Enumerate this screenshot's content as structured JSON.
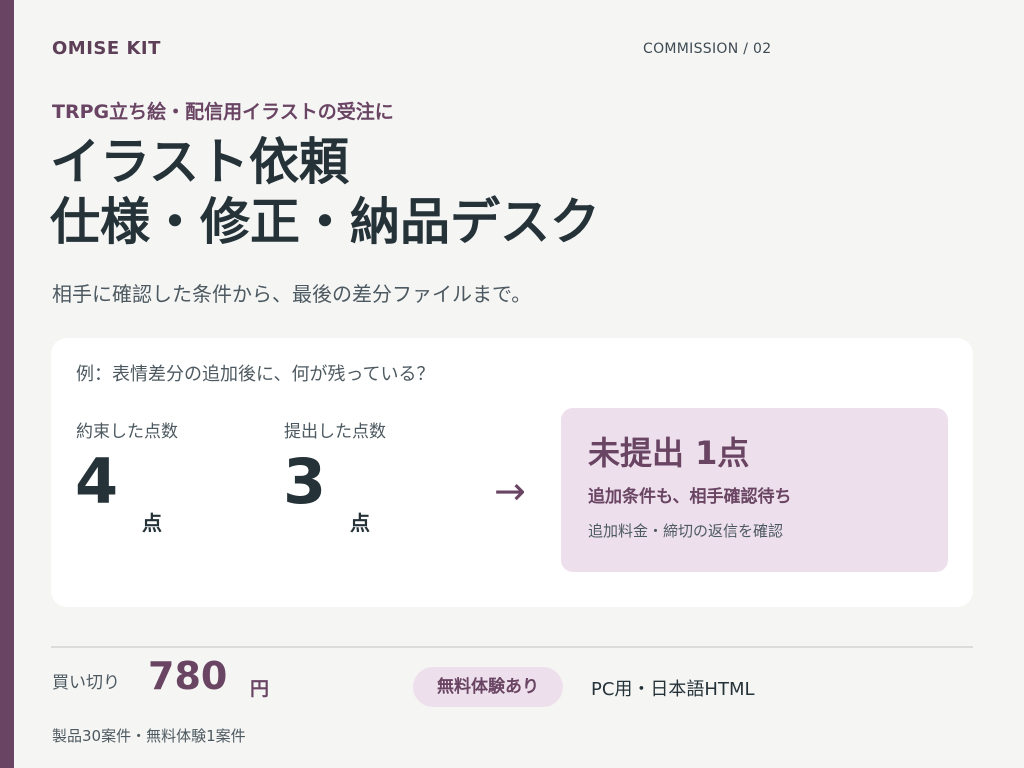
{
  "header": {
    "brand": "OMISE KIT",
    "section": "COMMISSION / 02"
  },
  "hero": {
    "eyebrow": "TRPG立ち絵・配信用イラストの受注に",
    "title_line1": "イラスト依頼",
    "title_line2": "仕様・修正・納品デスク",
    "subtitle": "相手に確認した条件から、最後の差分ファイルまで。"
  },
  "example": {
    "question": "例：表情差分の追加後に、何が残っている？",
    "promised": {
      "label": "約束した点数",
      "value": "4",
      "unit": "点"
    },
    "submitted": {
      "label": "提出した点数",
      "value": "3",
      "unit": "点"
    },
    "arrow": "→",
    "result": {
      "title": "未提出 1点",
      "subtitle": "追加条件も、相手確認待ち",
      "note": "追加料金・締切の返信を確認"
    }
  },
  "footer": {
    "buy_label": "買い切り",
    "price": "780",
    "currency": "円",
    "trial_badge": "無料体験あり",
    "platform": "PC用・日本語HTML",
    "stock": "製品30案件・無料体験1案件"
  },
  "colors": {
    "accent": "#6a4563",
    "accent_soft": "#ede0ec",
    "text_dark": "#253339",
    "background": "#f5f5f4"
  }
}
